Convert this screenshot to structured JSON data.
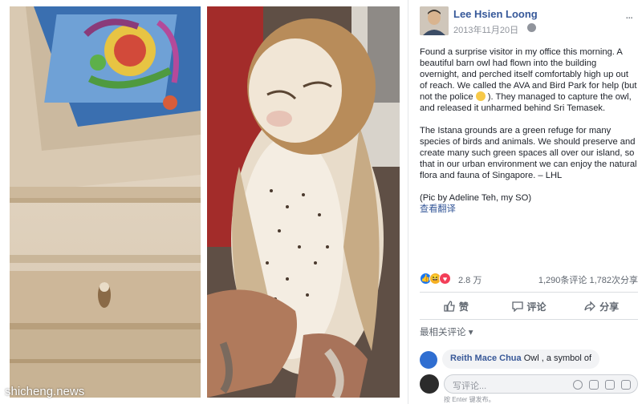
{
  "post": {
    "author": "Lee Hsien Loong",
    "timestamp": "2013年11月20日",
    "menu": "...",
    "paragraph1_before_emoji": "Found a surprise visitor in my office this morning. A beautiful barn owl had flown into the building overnight, and perched itself comfortably high up out of reach. We called the AVA and Bird Park for help (but not the police",
    "paragraph1_after_emoji": "). They managed to capture the owl, and released it unharmed behind Sri Temasek.",
    "paragraph2": "The Istana grounds are a green refuge for many species of birds and animals. We should preserve and create many such green spaces all over our island, so that in our urban environment we can enjoy the natural flora and fauna of Singapore. – LHL",
    "credit": "(Pic by Adeline Teh, my SO)",
    "translate": "查看翻译"
  },
  "reactions": {
    "total": "2.8 万",
    "comments": "1,290条评论",
    "shares": "1,782次分享"
  },
  "actions": {
    "like": "赞",
    "comment": "评论",
    "share": "分享"
  },
  "comments": {
    "sort_label": "最相关评论 ▾",
    "first": {
      "name": "Reith Mace Chua",
      "text": "Owl , a symbol of"
    },
    "placeholder": "写评论...",
    "enter_hint": "按 Enter 键发布。"
  },
  "watermark": "shicheng.news",
  "colors": {
    "link": "#365899",
    "text": "#1d2129",
    "muted": "#90949c"
  }
}
